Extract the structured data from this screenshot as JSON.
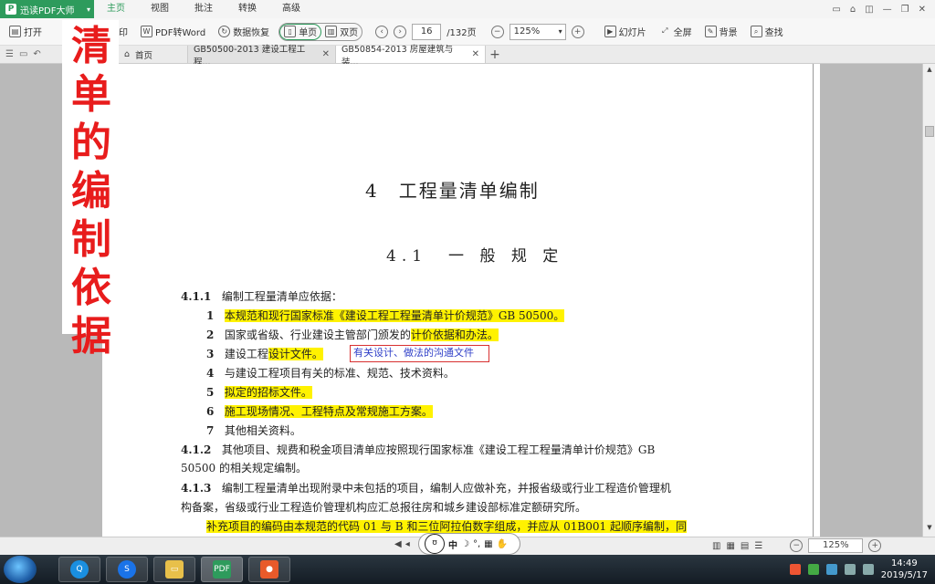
{
  "titlebar": {
    "app_name": "迅读PDF大师",
    "menu": [
      "主页",
      "视图",
      "批注",
      "转换",
      "高级"
    ],
    "active_menu": 0
  },
  "toolbar": {
    "open": "打开",
    "print": "印",
    "pdf_to_word": "PDF转Word",
    "data_recover": "数据恢复",
    "single_page": "单页",
    "double_page": "双页",
    "current_page": "16",
    "total_pages": "/132页",
    "zoom": "125%",
    "slideshow": "幻灯片",
    "fullscreen": "全屏",
    "background": "背景",
    "find": "查找"
  },
  "tabs": {
    "home": "首页",
    "tab1": "GB50500-2013 建设工程工程...",
    "tab2": "GB50854-2013 房屋建筑与装..."
  },
  "overlay": {
    "vertical_text": [
      "清",
      "单",
      "的",
      "编",
      "制",
      "依",
      "据"
    ],
    "color": "#e81c1c"
  },
  "document": {
    "chapter": "4　工程量清单编制",
    "section": "4.1　一 般 规 定",
    "clause_411_num": "4.1.1",
    "clause_411_text": "编制工程量清单应依据：",
    "items": [
      {
        "n": "1",
        "text": "本规范和现行国家标准《建设工程工程量清单计价规范》GB 50500。",
        "hl": true
      },
      {
        "n": "2",
        "text_plain": "国家或省级、行业建设主管部门颁发的",
        "text_hl": "计价依据和办法。"
      },
      {
        "n": "3",
        "text_plain": "建设工程",
        "text_hl": "设计文件。"
      },
      {
        "n": "4",
        "text": "与建设工程项目有关的标准、规范、技术资料。",
        "hl": false
      },
      {
        "n": "5",
        "text": "拟定的招标文件。",
        "hl": true
      },
      {
        "n": "6",
        "text": "施工现场情况、工程特点及常规施工方案。",
        "hl": true
      },
      {
        "n": "7",
        "text": "其他相关资料。",
        "hl": false
      }
    ],
    "annotation": "有关设计、做法的沟通文件",
    "clause_412_num": "4.1.2",
    "clause_412_text": "其他项目、规费和税金项目清单应按照现行国家标准《建设工程工程量清单计价规范》GB",
    "clause_412_cont": "50500 的相关规定编制。",
    "clause_413_num": "4.1.3",
    "clause_413_text": "编制工程量清单出现附录中未包括的项目，编制人应做补充，并报省级或行业工程造价管理机",
    "clause_413_cont": "构备案，省级或行业工程造价管理机构应汇总报往房和城乡建设部标准定额研究所。",
    "clause_413_hl": "补充项目的编码由本规范的代码 01 与 B 和三位阿拉伯数字组成，并应从 01B001 起顺序编制，同"
  },
  "statusbar": {
    "ime": "中",
    "zoom": "125%"
  },
  "taskbar": {
    "time": "14:49",
    "date": "2019/5/17"
  },
  "colors": {
    "accent": "#2e9b5c",
    "highlight": "#fff200",
    "annotation_border": "#d83030",
    "annotation_text": "#3040c8"
  }
}
